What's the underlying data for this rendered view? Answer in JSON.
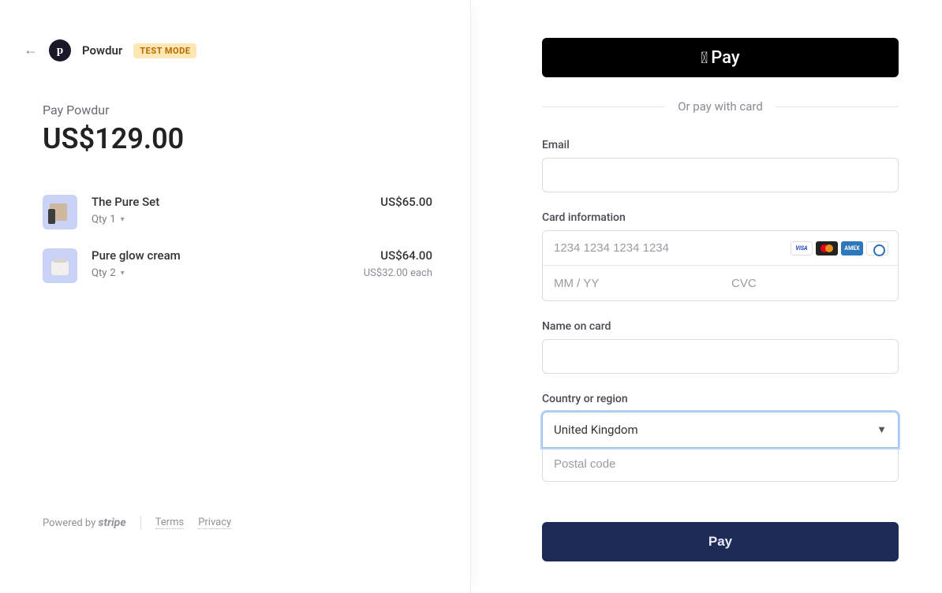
{
  "header": {
    "brand_name": "Powdur",
    "logo_letter": "p",
    "test_badge": "TEST MODE"
  },
  "summary": {
    "pay_label": "Pay Powdur",
    "total": "US$129.00"
  },
  "items": [
    {
      "title": "The Pure Set",
      "qty_label": "Qty",
      "qty_value": "1",
      "price": "US$65.00",
      "each": ""
    },
    {
      "title": "Pure glow cream",
      "qty_label": "Qty",
      "qty_value": "2",
      "price": "US$64.00",
      "each": "US$32.00 each"
    }
  ],
  "footer": {
    "powered_by": "Powered by",
    "stripe": "stripe",
    "terms": "Terms",
    "privacy": "Privacy"
  },
  "payment": {
    "apple_pay": "Pay",
    "or_text": "Or pay with card",
    "email_label": "Email",
    "card_label": "Card information",
    "card_number_placeholder": "1234 1234 1234 1234",
    "expiry_placeholder": "MM / YY",
    "cvc_placeholder": "CVC",
    "name_label": "Name on card",
    "country_label": "Country or region",
    "country_value": "United Kingdom",
    "postal_placeholder": "Postal code",
    "pay_button": "Pay"
  },
  "card_brands": {
    "visa": "VISA",
    "amex": "AMEX"
  }
}
